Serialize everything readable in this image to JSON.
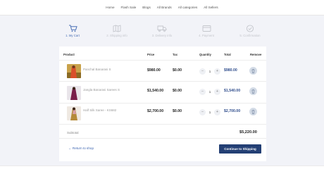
{
  "nav": {
    "items": [
      "Home",
      "Flash Sale",
      "Blogs",
      "All Brands",
      "All categories",
      "All Sellers"
    ]
  },
  "steps": [
    {
      "label": "1. My Cart",
      "icon": "shopping-cart-icon",
      "active": true
    },
    {
      "label": "2. Shipping info",
      "icon": "map-icon",
      "active": false
    },
    {
      "label": "3. Delivery info",
      "icon": "delivery-truck-icon",
      "active": false
    },
    {
      "label": "4. Payment",
      "icon": "credit-card-icon",
      "active": false
    },
    {
      "label": "5. Confirmation",
      "icon": "check-circle-icon",
      "active": false
    }
  ],
  "table": {
    "headers": {
      "product": "Product",
      "price": "Price",
      "tax": "Tax",
      "quantity": "Quantity",
      "total": "Total",
      "remove": "Remove"
    },
    "rows": [
      {
        "name": "Panchal Banarasi S",
        "price": "$980.00",
        "tax": "$0.00",
        "qty": "1",
        "total": "$980.00"
      },
      {
        "name": "Jangla Banarasi Sarees S",
        "price": "$1,540.00",
        "tax": "$0.00",
        "qty": "1",
        "total": "$1,540.00"
      },
      {
        "name": "Half Silk Saree - KS682",
        "price": "$2,700.00",
        "tax": "$0.00",
        "qty": "1",
        "total": "$2,700.00"
      }
    ]
  },
  "summary": {
    "subtotal_label": "Subtotal",
    "subtotal_value": "$5,220.00"
  },
  "actions": {
    "return_label": "Return to shop",
    "continue_label": "Continue to Shipping"
  },
  "colors": {
    "accent": "#233f74",
    "active_step": "#4a6fb5",
    "inactive_step": "#c4c6cc",
    "page_bg": "#f2f3f8"
  }
}
